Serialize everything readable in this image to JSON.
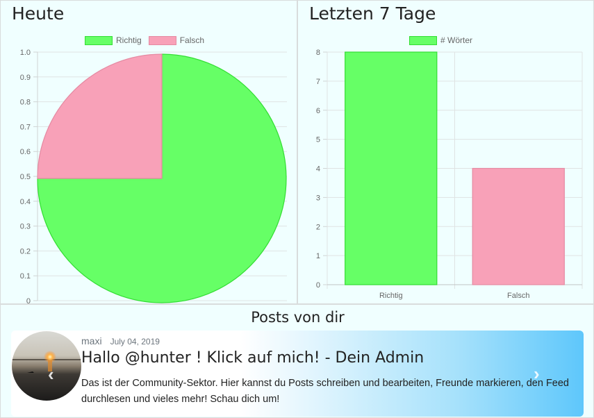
{
  "today": {
    "title": "Heute",
    "legend": [
      {
        "label": "Richtig",
        "color": "#66ff66",
        "border": "#33dd33"
      },
      {
        "label": "Falsch",
        "color": "#f8a1b8",
        "border": "#e58aa2"
      }
    ]
  },
  "week": {
    "title": "Letzten 7 Tage",
    "legend": [
      {
        "label": "# Wörter",
        "color": "#66ff66",
        "border": "#33dd33"
      }
    ]
  },
  "posts": {
    "title": "Posts von dir",
    "card": {
      "user": "maxi",
      "date": "July 04, 2019",
      "title": "Hallo @hunter ! Klick auf mich! - Dein Admin",
      "text": "Das ist der Community-Sektor. Hier kannst du Posts schreiben und bearbeiten, Freunde markieren, den Feed durchlesen und vieles mehr! Schau dich um!",
      "prev_icon": "chevron-left-icon",
      "next_icon": "chevron-right-icon"
    }
  },
  "chart_data": [
    {
      "type": "pie",
      "categories": [
        "Richtig",
        "Falsch"
      ],
      "values": [
        3,
        1
      ],
      "colors": [
        "#66ff66",
        "#f8a1b8"
      ],
      "ylim": [
        0,
        1
      ],
      "yticks": [
        "0",
        "0.1",
        "0.2",
        "0.3",
        "0.4",
        "0.5",
        "0.6",
        "0.7",
        "0.8",
        "0.9",
        "1.0"
      ],
      "legend": "top"
    },
    {
      "type": "bar",
      "categories": [
        "Richtig",
        "Falsch"
      ],
      "series": [
        {
          "name": "# Wörter",
          "values": [
            8,
            4
          ]
        }
      ],
      "colors": [
        "#66ff66",
        "#f8a1b8"
      ],
      "ylim": [
        0,
        8
      ],
      "yticks": [
        "0",
        "1",
        "2",
        "3",
        "4",
        "5",
        "6",
        "7",
        "8"
      ],
      "legend": "top"
    }
  ]
}
